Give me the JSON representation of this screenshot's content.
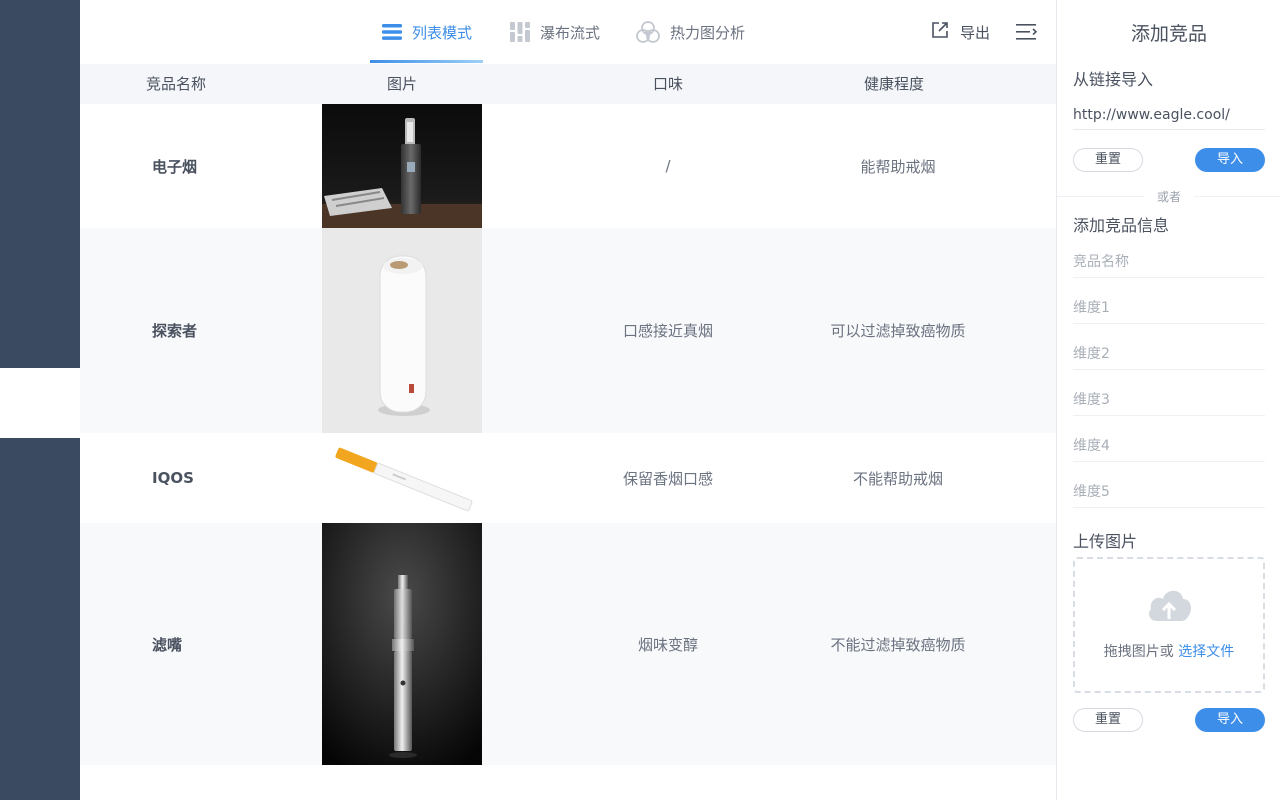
{
  "tabs": [
    {
      "label": "列表模式",
      "icon": "list-icon",
      "active": true
    },
    {
      "label": "瀑布流式",
      "icon": "waterfall-icon",
      "active": false
    },
    {
      "label": "热力图分析",
      "icon": "heatmap-icon",
      "active": false
    }
  ],
  "toolbar": {
    "export_label": "导出",
    "export_icon": "export-icon",
    "menu_icon": "collapse-menu-icon"
  },
  "table": {
    "headers": [
      "竞品名称",
      "图片",
      "口味",
      "健康程度"
    ],
    "rows": [
      {
        "name": "电子烟",
        "image": "e-cigarette-photo",
        "taste": "/",
        "health": "能帮助戒烟"
      },
      {
        "name": "探索者",
        "image": "white-device-photo",
        "taste": "口感接近真烟",
        "health": "可以过滤掉致癌物质"
      },
      {
        "name": "IQOS",
        "image": "cigarette-photo",
        "taste": "保留香烟口感",
        "health": "不能帮助戒烟"
      },
      {
        "name": "滤嘴",
        "image": "vape-pen-photo",
        "taste": "烟味变醇",
        "health": "不能过滤掉致癌物质"
      }
    ]
  },
  "panel": {
    "title": "添加竞品",
    "import_section": "从链接导入",
    "url_value": "http://www.eagle.cool/",
    "reset_label": "重置",
    "import_label": "导入",
    "or_label": "或者",
    "info_section": "添加竞品信息",
    "fields": [
      "竞品名称",
      "维度1",
      "维度2",
      "维度3",
      "维度4",
      "维度5"
    ],
    "upload_section": "上传图片",
    "drop_text": "拖拽图片或",
    "drop_link": "选择文件",
    "upload_icon": "cloud-upload-icon"
  },
  "colors": {
    "accent": "#3d8ee8",
    "rail": "#3a4a60",
    "header_bg": "#f4f6f9"
  }
}
